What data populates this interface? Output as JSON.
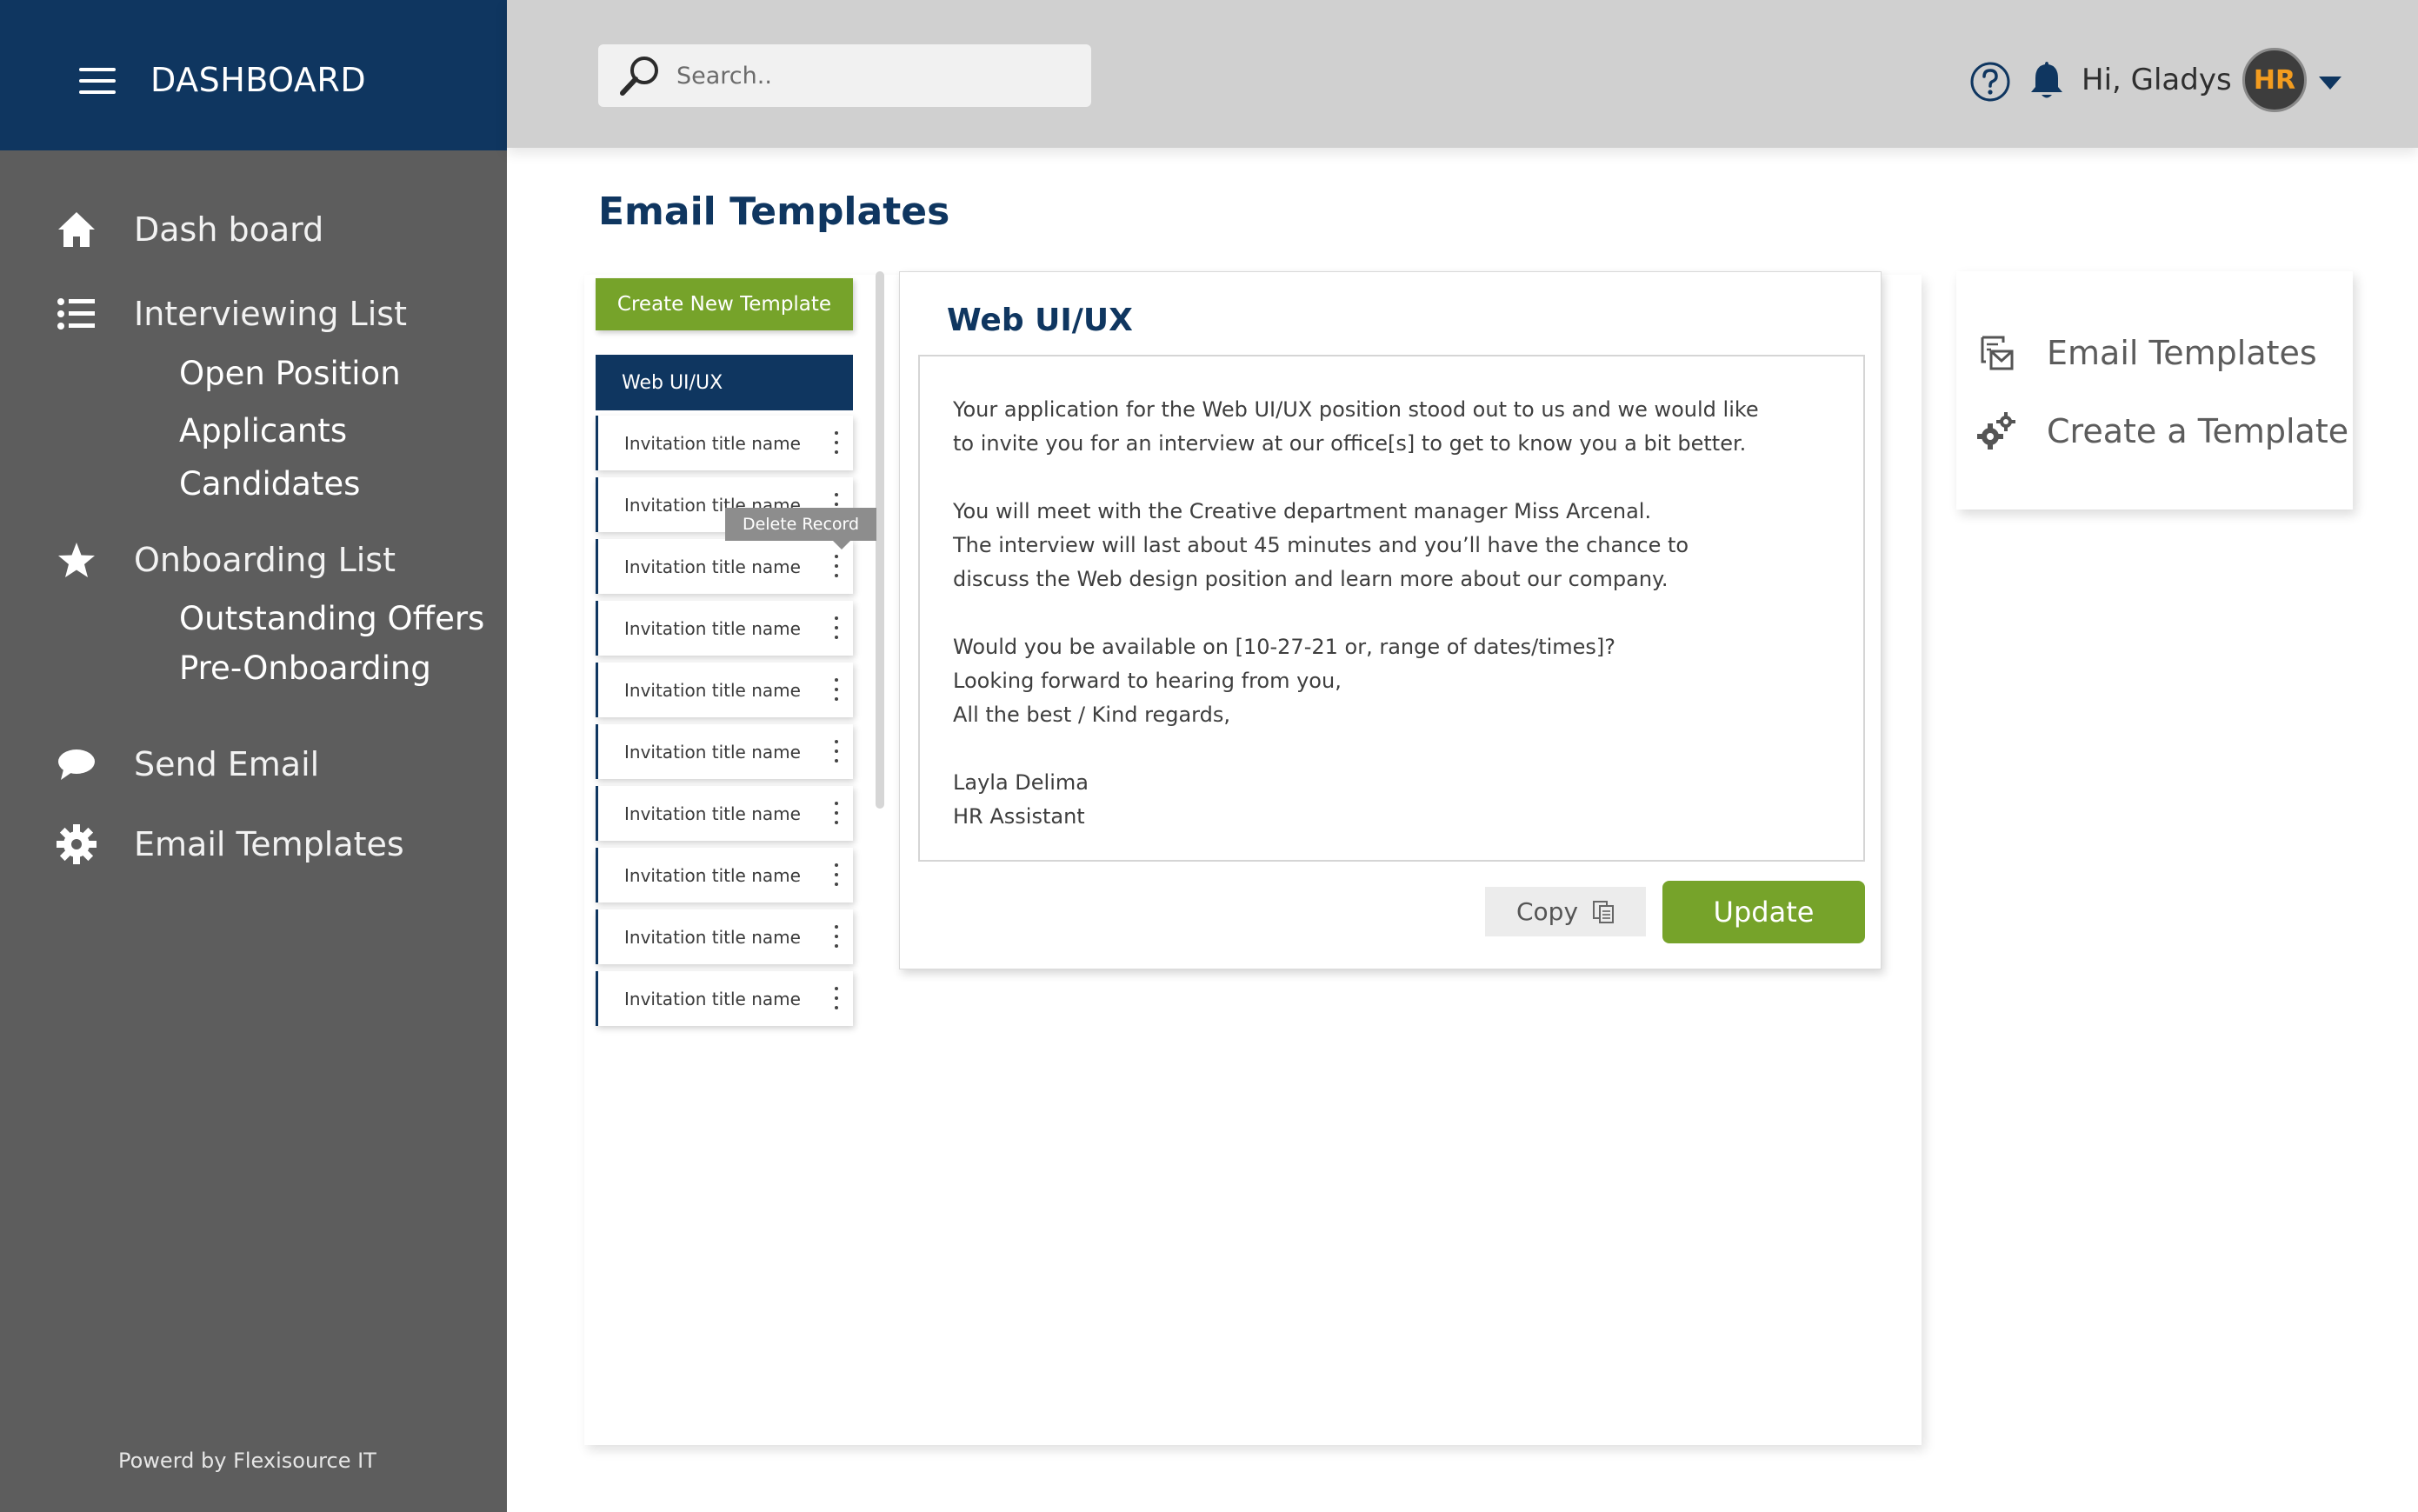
{
  "app": {
    "title": "DASHBOARD"
  },
  "sidebar": {
    "items": [
      {
        "label": "Dash board",
        "icon": "home-icon"
      },
      {
        "label": "Interviewing List",
        "icon": "list-icon"
      },
      {
        "label": "Onboarding List",
        "icon": "star-icon"
      },
      {
        "label": "Send Email",
        "icon": "chat-bubble-icon"
      },
      {
        "label": "Email Templates",
        "icon": "gear-icon"
      }
    ],
    "interviewing_sub": [
      "Open Position",
      "Applicants",
      "Candidates"
    ],
    "onboarding_sub": [
      "Outstanding Offers",
      "Pre-Onboarding"
    ],
    "footer": "Powerd by Flexisource IT"
  },
  "header": {
    "search_placeholder": "Search..",
    "greeting": "Hi, Gladys !",
    "avatar_text": "HR"
  },
  "main": {
    "title": "Email Templates",
    "create_button": "Create New Template",
    "active_template": "Web UI/UX",
    "templates": [
      "Invitation title name",
      "Invitation title name",
      "Invitation title name",
      "Invitation title name",
      "Invitation title name",
      "Invitation title name",
      "Invitation title name",
      "Invitation title name",
      "Invitation title name",
      "Invitation title name"
    ],
    "tooltip": "Delete Record",
    "editor": {
      "title": "Web UI/UX",
      "lines": [
        "Your application for the Web UI/UX position stood out to us and we would like",
        "to invite you for an interview at our office[s] to get to know you a bit better.",
        "",
        "You will meet with the Creative department manager Miss Arcenal.",
        "The interview will last about 45 minutes and you’ll have the chance to",
        "discuss the Web design position and learn more about our company.",
        "",
        "Would you be available on [10-27-21   or, range of dates/times]?",
        "Looking forward to hearing from you,",
        "All the best / Kind regards,",
        "",
        "Layla Delima",
        "HR Assistant"
      ],
      "copy_label": "Copy",
      "update_label": "Update"
    }
  },
  "right_menu": {
    "items": [
      {
        "label": "Email Templates",
        "icon": "email-template-icon"
      },
      {
        "label": "Create a Template",
        "icon": "gears-icon"
      }
    ]
  },
  "colors": {
    "navy": "#0f3660",
    "green": "#76a32a",
    "sidebar": "#5d5d5d",
    "topbar": "#d0d0d0"
  }
}
